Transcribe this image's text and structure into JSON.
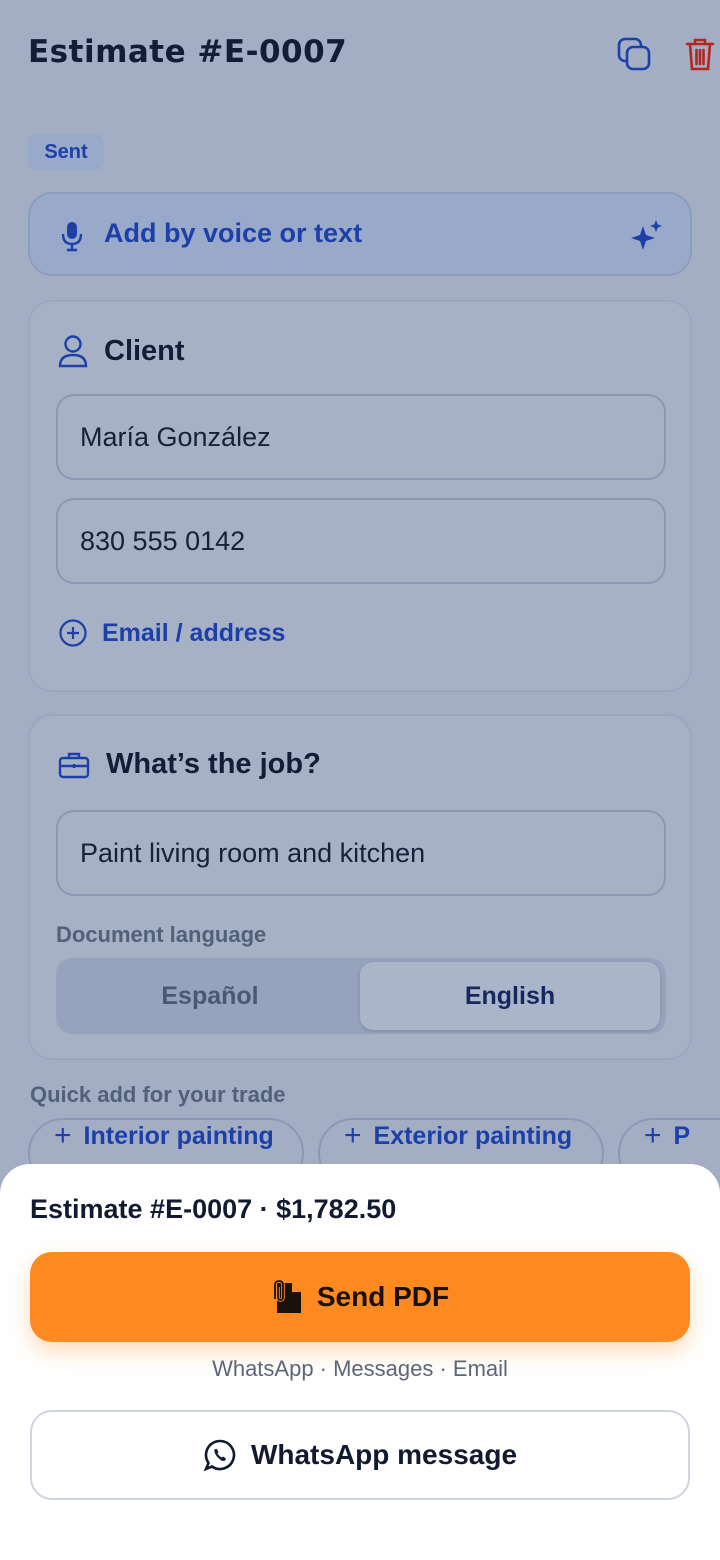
{
  "header": {
    "title": "Estimate #E-0007",
    "copy_icon": "copy-icon",
    "delete_icon": "trash-icon"
  },
  "status": {
    "badge": "Sent"
  },
  "voice": {
    "label": "Add by voice or text",
    "icon": "microphone-icon",
    "ai_icon": "sparkle-icon"
  },
  "client": {
    "heading": "Client",
    "name_value": "María González",
    "phone_value": "830 555 0142",
    "add_more_label": "Email / address"
  },
  "job": {
    "heading": "What’s the job?",
    "description_value": "Paint living room and kitchen",
    "language_label": "Document language",
    "language_options": [
      "Español",
      "English"
    ],
    "language_selected": "English"
  },
  "quick_add": {
    "label": "Quick add for your trade",
    "chips": [
      "Interior painting",
      "Exterior painting",
      "P"
    ]
  },
  "sheet": {
    "summary": "Estimate #E-0007 · $1,782.50",
    "send_label": "Send PDF",
    "channels": "WhatsApp · Messages · Email",
    "whatsapp_label": "WhatsApp message"
  },
  "colors": {
    "accent_blue": "#1c3fa8",
    "send_orange": "#fd8a21",
    "delete_red": "#b3261e"
  }
}
